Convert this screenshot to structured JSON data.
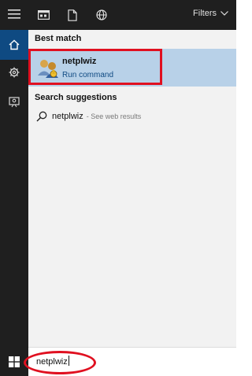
{
  "topbar": {
    "filters_label": "Filters"
  },
  "results": {
    "best_match_title": "Best match",
    "best_match": {
      "name": "netplwiz",
      "type": "Run command"
    },
    "search_suggestions_title": "Search suggestions",
    "suggestion": {
      "query": "netplwiz",
      "hint": "- See web results"
    }
  },
  "search": {
    "value": "netplwiz"
  },
  "colors": {
    "rail_bg": "#1f1f1f",
    "rail_selected": "#0f4a82",
    "best_match_bg": "#b8d1e8",
    "highlight_red": "#e01020",
    "link_blue": "#0f4a82"
  },
  "icons": {
    "hamburger": "hamburger-icon",
    "home": "home-icon",
    "settings": "gear-icon",
    "feedback": "feedback-icon",
    "apps": "apps-icon",
    "documents": "document-icon",
    "web": "globe-icon",
    "filters": "chevron-down-icon",
    "app": "users-app-icon",
    "suggestion": "search-icon",
    "windows": "windows-logo-icon"
  }
}
